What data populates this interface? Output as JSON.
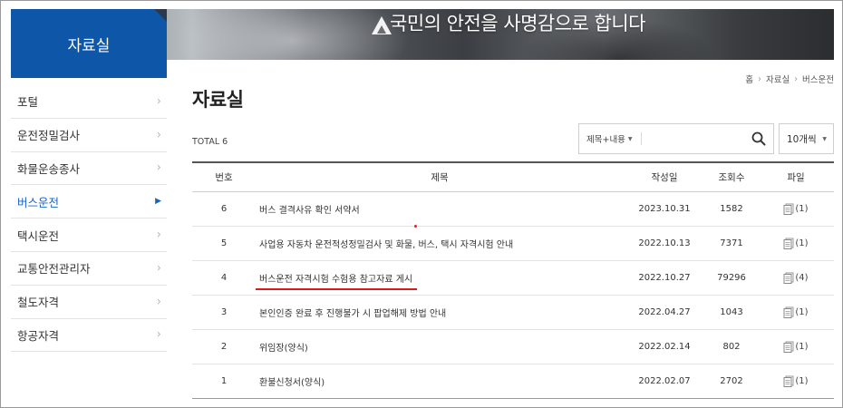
{
  "banner": {
    "slogan": "국민의 안전을 사명감으로 합니다"
  },
  "section": {
    "title": "자료실"
  },
  "sidebar": {
    "items": [
      {
        "label": "포털",
        "active": false
      },
      {
        "label": "운전정밀검사",
        "active": false
      },
      {
        "label": "화물운송종사",
        "active": false
      },
      {
        "label": "버스운전",
        "active": true
      },
      {
        "label": "택시운전",
        "active": false
      },
      {
        "label": "교통안전관리자",
        "active": false
      },
      {
        "label": "철도자격",
        "active": false
      },
      {
        "label": "항공자격",
        "active": false
      }
    ]
  },
  "breadcrumb": {
    "home": "홈",
    "level1": "자료실",
    "level2": "버스운전"
  },
  "page": {
    "title": "자료실",
    "total": "TOTAL 6"
  },
  "search": {
    "scope": "제목+내용",
    "value": "",
    "per_page": "10개씩"
  },
  "table": {
    "headers": {
      "num": "번호",
      "title": "제목",
      "date": "작성일",
      "views": "조회수",
      "file": "파일"
    },
    "rows": [
      {
        "num": "6",
        "title": "버스 결격사유 확인 서약서",
        "date": "2023.10.31",
        "views": "1582",
        "files": "(1)"
      },
      {
        "num": "5",
        "title": "사업용 자동차 운전적성정밀검사 및 화물, 버스, 택시 자격시험 안내",
        "date": "2022.10.13",
        "views": "7371",
        "files": "(1)"
      },
      {
        "num": "4",
        "title": "버스운전 자격시험 수험용 참고자료 게시",
        "date": "2022.10.27",
        "views": "79296",
        "files": "(4)"
      },
      {
        "num": "3",
        "title": "본인인증 완료 후 진행불가 시 팝업해제 방법 안내",
        "date": "2022.04.27",
        "views": "1043",
        "files": "(1)"
      },
      {
        "num": "2",
        "title": "위임장(양식)",
        "date": "2022.02.14",
        "views": "802",
        "files": "(1)"
      },
      {
        "num": "1",
        "title": "환불신청서(양식)",
        "date": "2022.02.07",
        "views": "2702",
        "files": "(1)"
      }
    ]
  },
  "colors": {
    "brand": "#0e56a8",
    "active_link": "#1a64c8",
    "highlight": "#d81b1b"
  }
}
